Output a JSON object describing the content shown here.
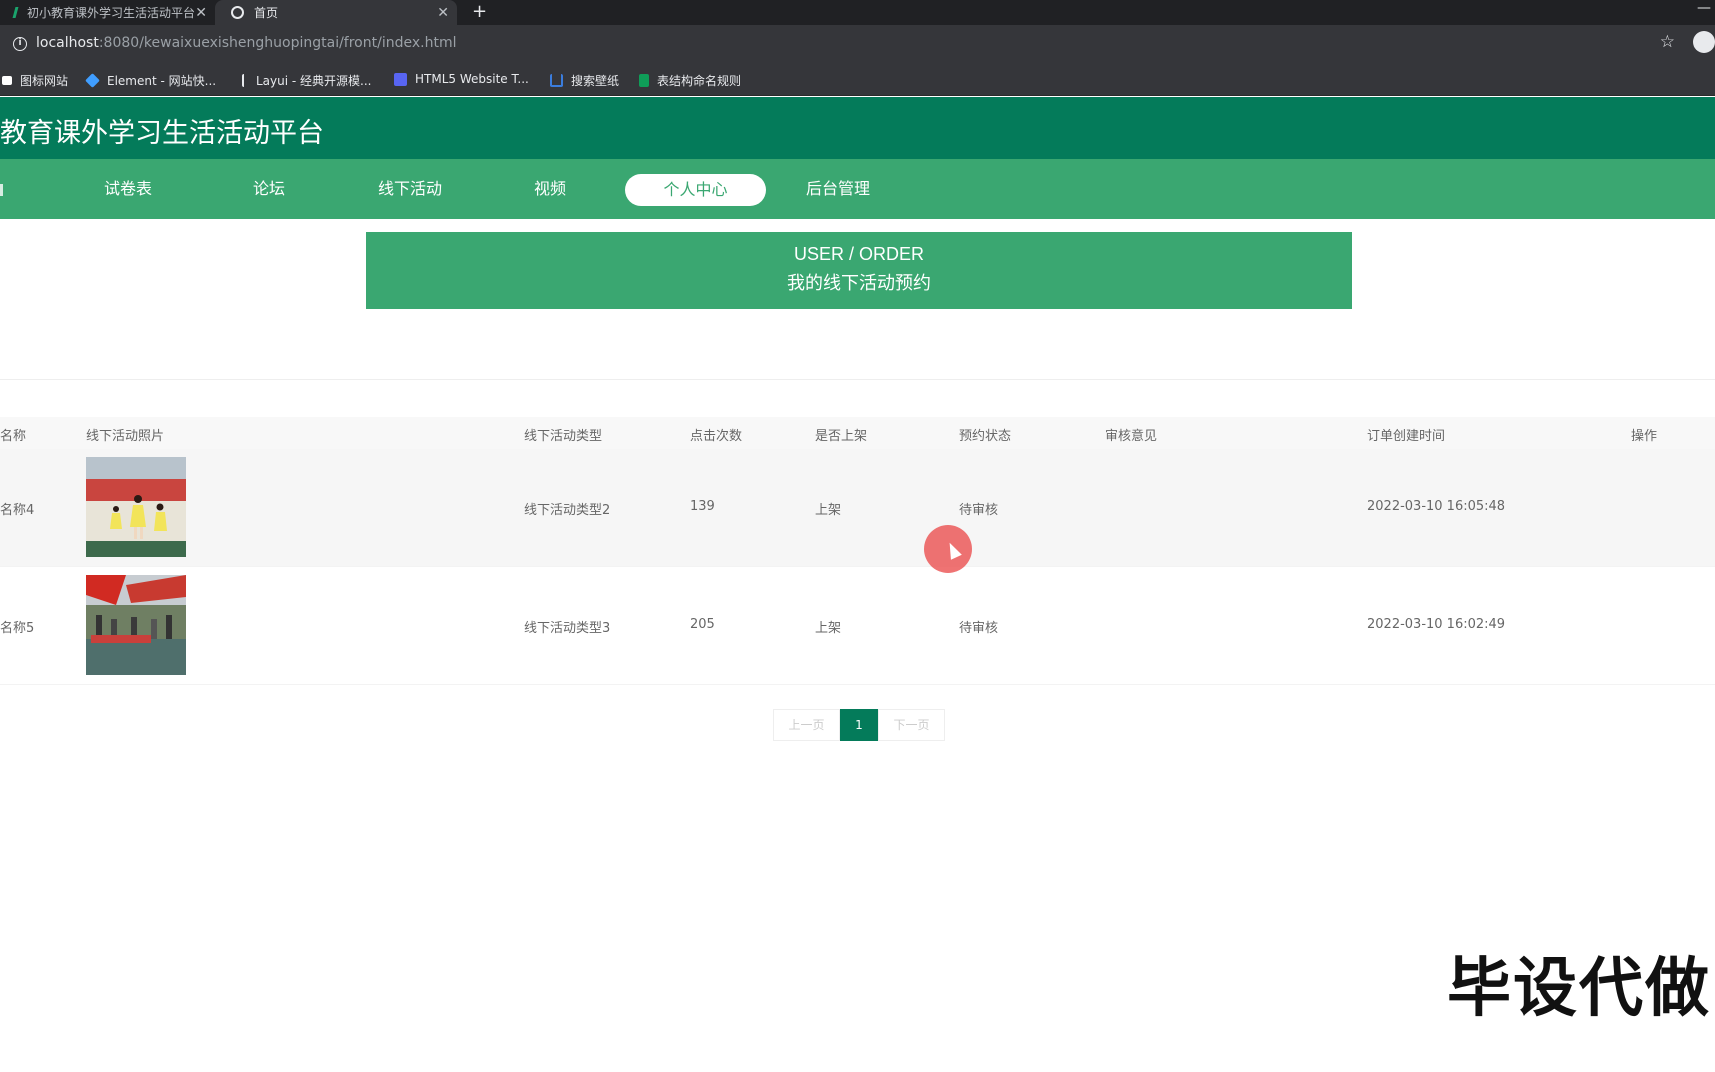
{
  "browser": {
    "tabs": [
      {
        "title": "初小教育课外学习生活活动平台",
        "active": false
      },
      {
        "title": "首页",
        "active": true
      }
    ],
    "url_host": "localhost",
    "url_rest": ":8080/kewaixuexishenghuopingtai/front/index.html",
    "bookmarks": [
      {
        "label": "图标网站",
        "icon": "flag-icon",
        "color": "#ffffff"
      },
      {
        "label": "Element - 网站快...",
        "icon": "element-icon",
        "color": "#409eff"
      },
      {
        "label": "Layui - 经典开源模...",
        "icon": "layui-icon",
        "color": "#e8eaed"
      },
      {
        "label": "HTML5 Website T...",
        "icon": "html5-icon",
        "color": "#5865f2"
      },
      {
        "label": "搜索壁纸",
        "icon": "wallhaven-icon",
        "color": "#3b7ddd"
      },
      {
        "label": "表结构命名规则",
        "icon": "sheet-icon",
        "color": "#0f9d58"
      }
    ]
  },
  "site": {
    "title": "教育课外学习生活活动平台",
    "nav": [
      {
        "label": "试卷表",
        "active": false
      },
      {
        "label": "论坛",
        "active": false
      },
      {
        "label": "线下活动",
        "active": false
      },
      {
        "label": "视频",
        "active": false
      },
      {
        "label": "个人中心",
        "active": true
      },
      {
        "label": "后台管理",
        "active": false
      }
    ],
    "banner": {
      "en": "USER / ORDER",
      "zh": "我的线下活动预约"
    }
  },
  "table": {
    "headers": [
      "名称",
      "线下活动照片",
      "线下活动类型",
      "点击次数",
      "是否上架",
      "预约状态",
      "审核意见",
      "订单创建时间",
      "操作"
    ],
    "rows": [
      {
        "name": "名称4",
        "type": "线下活动类型2",
        "clicks": "139",
        "onshelf": "上架",
        "status": "待审核",
        "opinion": "",
        "created": "2022-03-10 16:05:48"
      },
      {
        "name": "名称5",
        "type": "线下活动类型3",
        "clicks": "205",
        "onshelf": "上架",
        "status": "待审核",
        "opinion": "",
        "created": "2022-03-10 16:02:49"
      }
    ]
  },
  "pagination": {
    "prev": "上一页",
    "current": "1",
    "next": "下一页"
  },
  "watermark": "毕设代做",
  "colors": {
    "header": "#047b5a",
    "nav": "#3aa771",
    "accent": "#047b5a"
  }
}
